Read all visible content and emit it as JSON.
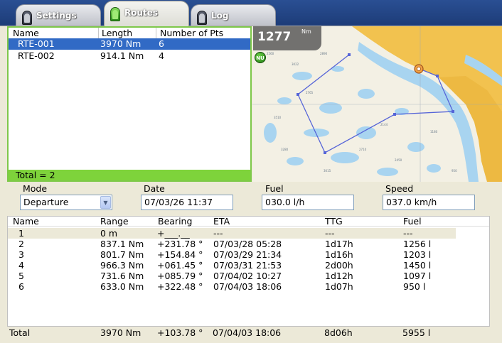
{
  "tabs": [
    {
      "label": "Settings",
      "active": false
    },
    {
      "label": "Routes",
      "active": true
    },
    {
      "label": "Log",
      "active": false
    }
  ],
  "routes": {
    "columns": [
      "Name",
      "Length",
      "Number of Pts"
    ],
    "rows": [
      {
        "name": "RTE-001",
        "length": "3970 Nm",
        "pts": "6",
        "selected": true
      },
      {
        "name": "RTE-002",
        "length": "914.1 Nm",
        "pts": "4",
        "selected": false
      }
    ],
    "total": "Total = 2"
  },
  "map": {
    "scale_value": "1277",
    "scale_unit": "Nm",
    "nu_label": "NU",
    "colors": {
      "water": "#f3f0e4",
      "land": "#f2c24f",
      "shallow": "#a8d4f0",
      "route": "#5564d8"
    }
  },
  "controls": {
    "mode_label": "Mode",
    "mode_value": "Departure",
    "date_label": "Date",
    "date_value": "07/03/26 11:37",
    "fuel_label": "Fuel",
    "fuel_value": "030.0 l/h",
    "speed_label": "Speed",
    "speed_value": "037.0 km/h"
  },
  "waypoints": {
    "columns": [
      "Name",
      "Range",
      "Bearing",
      "ETA",
      "TTG",
      "Fuel"
    ],
    "rows": [
      {
        "name": "1",
        "range": "0 m",
        "bearing": "+___.__",
        "eta": "---",
        "ttg": "---",
        "fuel": "---",
        "selected": true
      },
      {
        "name": "2",
        "range": "837.1 Nm",
        "bearing": "+231.78 °",
        "eta": "07/03/28 05:28",
        "ttg": "1d17h",
        "fuel": "1256 l",
        "selected": false
      },
      {
        "name": "3",
        "range": "801.7 Nm",
        "bearing": "+154.84 °",
        "eta": "07/03/29 21:34",
        "ttg": "1d16h",
        "fuel": "1203 l",
        "selected": false
      },
      {
        "name": "4",
        "range": "966.3 Nm",
        "bearing": "+061.45 °",
        "eta": "07/03/31 21:53",
        "ttg": "2d00h",
        "fuel": "1450 l",
        "selected": false
      },
      {
        "name": "5",
        "range": "731.6 Nm",
        "bearing": "+085.79 °",
        "eta": "07/04/02 10:27",
        "ttg": "1d12h",
        "fuel": "1097 l",
        "selected": false
      },
      {
        "name": "6",
        "range": "633.0 Nm",
        "bearing": "+322.48 °",
        "eta": "07/04/03 18:06",
        "ttg": "1d07h",
        "fuel": "950 l",
        "selected": false
      }
    ],
    "total": {
      "name": "Total",
      "range": "3970 Nm",
      "bearing": "+103.78 °",
      "eta": "07/04/03 18:06",
      "ttg": "8d06h",
      "fuel": "5955 l"
    }
  }
}
